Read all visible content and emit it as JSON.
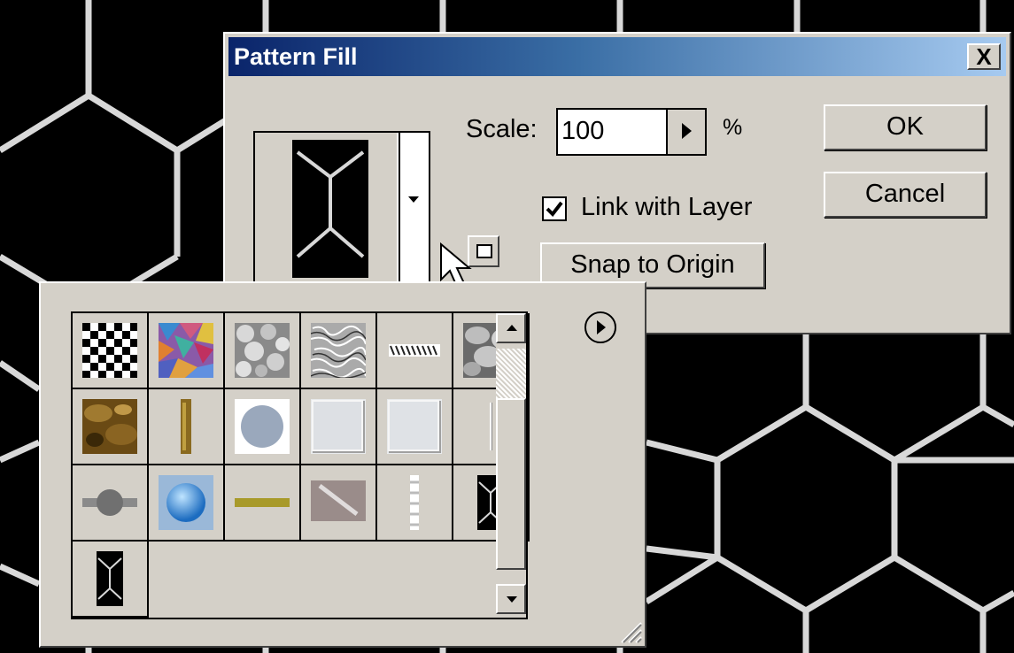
{
  "dialog": {
    "title": "Pattern Fill",
    "close_label": "X",
    "scale_label": "Scale:",
    "scale_value": "100",
    "percent_label": "%",
    "link_label": "Link with Layer",
    "link_checked": true,
    "snap_label": "Snap to Origin",
    "ok_label": "OK",
    "cancel_label": "Cancel"
  },
  "picker": {
    "swatches": [
      "checkerboard-warp",
      "colorful-mosaic",
      "bubbles-gray",
      "noise-gray",
      "wrinkle-strip",
      "clouds-gray",
      "brown-stone",
      "gold-bar",
      "gray-circle",
      "light-gray-tile",
      "light-gray-tile-2",
      "thin-line",
      "knob-bar",
      "blue-sphere",
      "gold-line",
      "diagonal-stripe",
      "dashed-strip",
      "hex-pattern",
      "hex-pattern-2"
    ]
  },
  "icons": {
    "menu": "flyout-menu-icon",
    "cursor": "arrow-cursor-icon",
    "new_pattern": "new-preset-icon"
  }
}
